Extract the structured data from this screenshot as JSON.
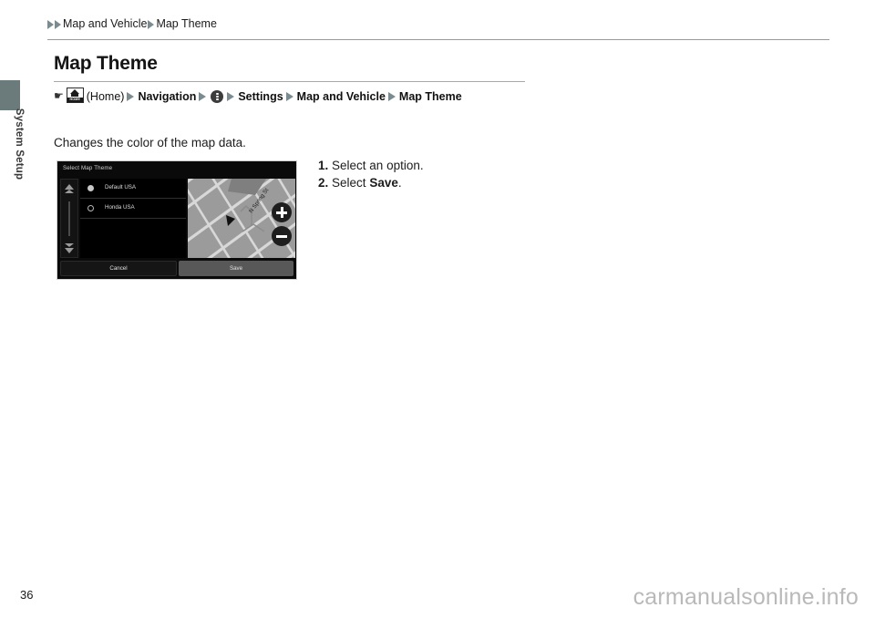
{
  "sidebar": {
    "tab_label": "System Setup",
    "tab_color": "#6b7a7b"
  },
  "breadcrumb": {
    "arrow_icon": "triangle-right-icon",
    "segments": [
      "Map and Vehicle",
      "Map Theme"
    ]
  },
  "page": {
    "title": "Map Theme",
    "body_text": "Changes the color of the map data.",
    "page_number": "36",
    "watermark": "carmanualsonline.info"
  },
  "nav_path": {
    "hand_icon": "hand-pointer-icon",
    "home_icon": "home-button-icon",
    "home_icon_text": "HOME",
    "home_label": "(Home)",
    "menu_icon": "three-dots-circle-icon",
    "steps": [
      "Navigation",
      "Settings",
      "Map and Vehicle",
      "Map Theme"
    ]
  },
  "steps": [
    {
      "number": "1.",
      "text": "Select an option.",
      "bold": ""
    },
    {
      "number": "2.",
      "prefix": "Select ",
      "bold": "Save",
      "suffix": "."
    }
  ],
  "nav_screen": {
    "title": "Select Map Theme",
    "scroll_up_icon": "scroll-up-arrow-icon",
    "scroll_down_icon": "scroll-down-arrow-icon",
    "options": [
      {
        "label": "Default USA",
        "selected": true
      },
      {
        "label": "Honda USA",
        "selected": false
      }
    ],
    "map": {
      "street_label": "N Spring St",
      "vehicle_marker_icon": "vehicle-arrow-icon",
      "zoom_in_icon": "plus-circle-icon",
      "zoom_out_icon": "minus-circle-icon",
      "road_color": "#d2d2d2",
      "block_color": "#9b9b9b"
    },
    "buttons": {
      "cancel": "Cancel",
      "save": "Save"
    }
  }
}
